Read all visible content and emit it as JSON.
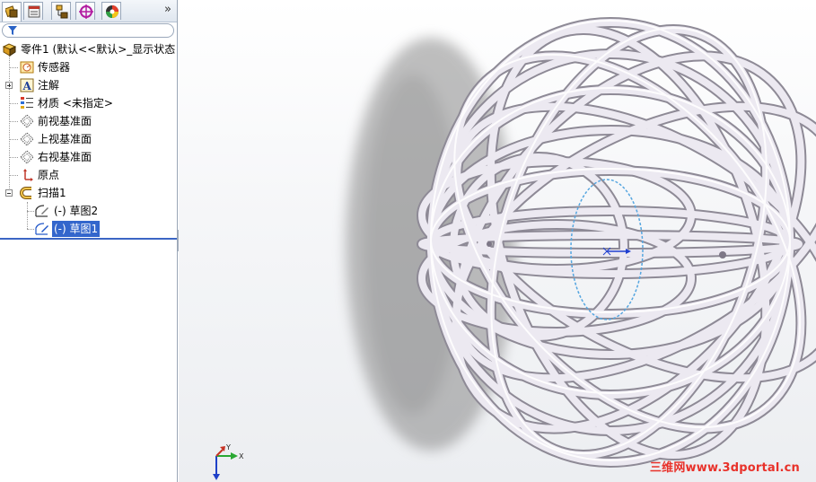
{
  "feature_manager": {
    "tabs": [
      {
        "name": "feature-manager-tab"
      },
      {
        "name": "property-manager-tab"
      },
      {
        "name": "configuration-manager-tab"
      },
      {
        "name": "dimxpert-manager-tab"
      },
      {
        "name": "display-manager-tab"
      }
    ],
    "more_tabs_glyph": "»",
    "tree": {
      "root_label": "零件1  (默认<<默认>_显示状态",
      "items": [
        {
          "label": "传感器",
          "icon": "sensor-icon"
        },
        {
          "label": "注解",
          "icon": "annotations-icon"
        },
        {
          "label": "材质 <未指定>",
          "icon": "material-icon"
        },
        {
          "label": "前视基准面",
          "icon": "plane-icon"
        },
        {
          "label": "上视基准面",
          "icon": "plane-icon"
        },
        {
          "label": "右视基准面",
          "icon": "plane-icon"
        },
        {
          "label": "原点",
          "icon": "origin-icon"
        },
        {
          "label": "扫描1",
          "icon": "sweep-icon"
        },
        {
          "label": "(-) 草图2",
          "icon": "sketch-icon"
        },
        {
          "label": "(-) 草图1",
          "icon": "sketch-icon"
        }
      ]
    }
  },
  "graphics": {
    "triad_labels": {
      "y": "Y",
      "x": "X"
    },
    "background_color": "#f2f3f5",
    "sketch_color": "#55a6e0",
    "tube_color": "#e9e6ee"
  },
  "watermark": "三维网www.3dportal.cn"
}
